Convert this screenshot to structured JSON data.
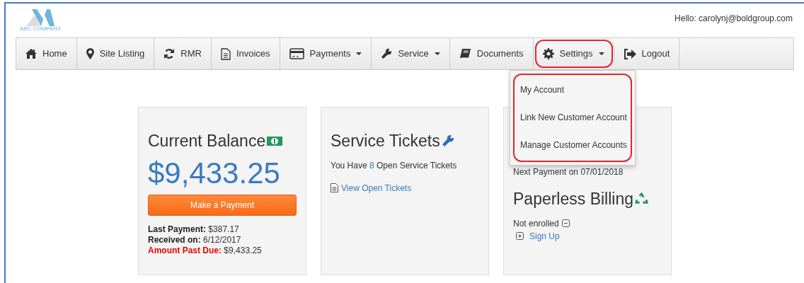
{
  "header": {
    "logo_text": "ABC COMPANY",
    "greeting": "Hello: carolynj@boldgroup.com"
  },
  "nav": [
    {
      "label": "Home",
      "caret": false,
      "highlighted": false
    },
    {
      "label": "Site Listing",
      "caret": false,
      "highlighted": false
    },
    {
      "label": "RMR",
      "caret": false,
      "highlighted": false
    },
    {
      "label": "Invoices",
      "caret": false,
      "highlighted": false
    },
    {
      "label": "Payments",
      "caret": true,
      "highlighted": false
    },
    {
      "label": "Service",
      "caret": true,
      "highlighted": false
    },
    {
      "label": "Documents",
      "caret": false,
      "highlighted": false
    },
    {
      "label": "Settings",
      "caret": true,
      "highlighted": true
    },
    {
      "label": "Logout",
      "caret": false,
      "highlighted": false
    }
  ],
  "dropdown": {
    "highlighted": true,
    "items": [
      "My Account",
      "Link New Customer Account",
      "Manage Customer Accounts"
    ]
  },
  "cards": [
    {
      "kind": "balance",
      "title": "Current Balance",
      "amount": "$9,433.25",
      "button": "Make a Payment",
      "lines": [
        {
          "label": "Last Payment:",
          "value": "$387.17",
          "alert": false
        },
        {
          "label": "Received on:",
          "value": "6/12/2017",
          "alert": false
        },
        {
          "label": "Amount Past Due:",
          "value": "$9,433.25",
          "alert": true
        }
      ]
    },
    {
      "kind": "tickets",
      "title": "Service Tickets",
      "prefix": "You Have",
      "count": "8",
      "suffix": "Open Service Tickets",
      "link": "View Open Tickets"
    },
    {
      "kind": "billing",
      "next_payment": "Next Payment on 07/01/2018",
      "title": "Paperless Billing",
      "status": "Not enrolled",
      "link": "Sign Up"
    }
  ]
}
